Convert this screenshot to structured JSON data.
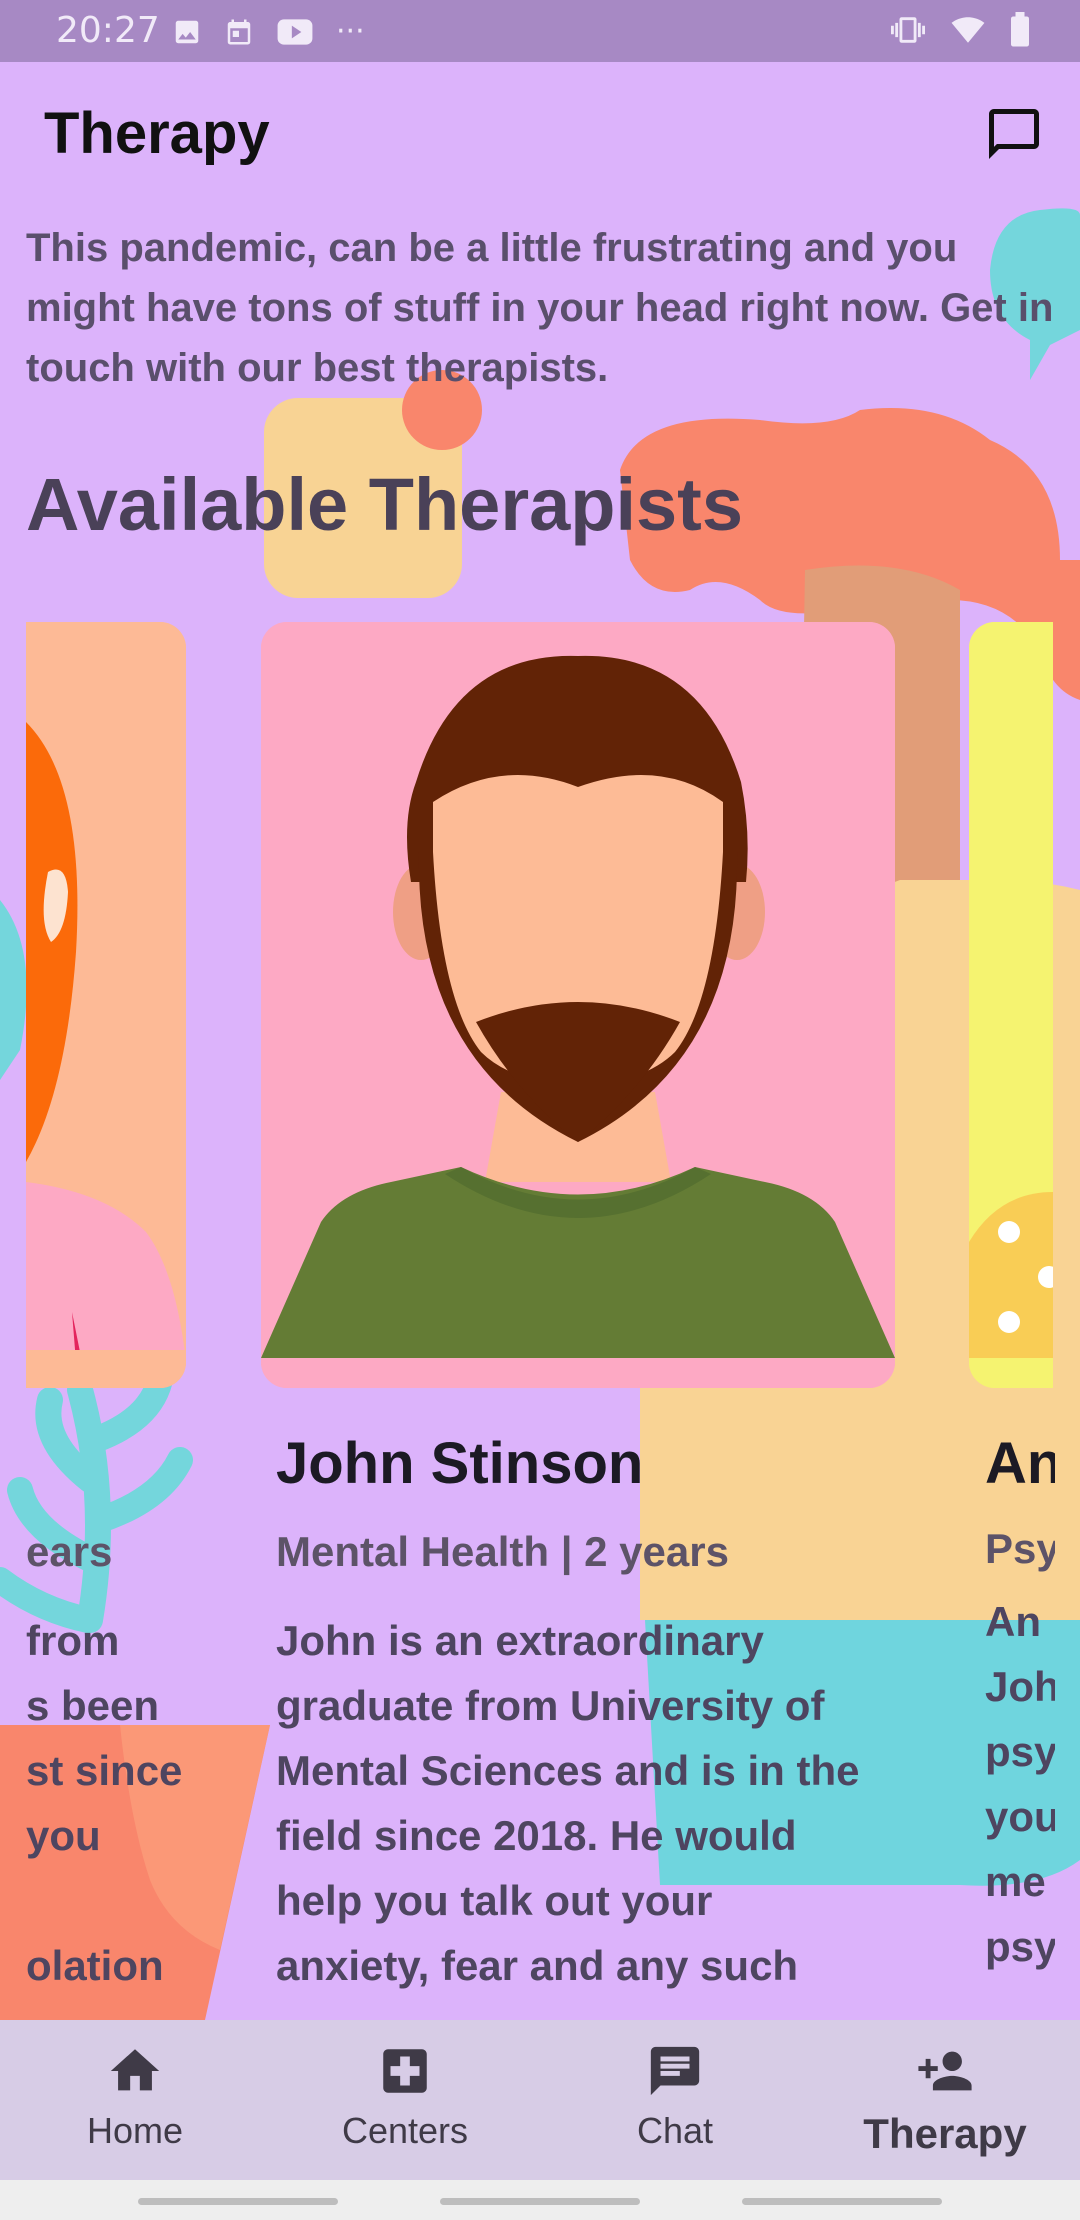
{
  "status_bar": {
    "time": "20:27",
    "overflow": "···"
  },
  "app_bar": {
    "title": "Therapy",
    "chat_icon": "chat-bubble-outline-icon"
  },
  "intro_text": "This pandemic, can be a little frustrating and you might have tons of stuff in your head right now. Get in touch with our best therapists.",
  "section_title": "Available Therapists",
  "therapists": [
    {
      "name": "",
      "specialty": "ears",
      "description_lines": [
        "from",
        "s been",
        "st since",
        "you",
        "",
        "olation"
      ]
    },
    {
      "name": "John Stinson",
      "specialty": "Mental Health | 2 years",
      "description_lines": [
        "John is an extraordinary",
        "graduate from University of",
        "Mental Sciences and is in the",
        "field since 2018. He would",
        "help you talk out your",
        "anxiety, fear and any such"
      ]
    },
    {
      "name": "An",
      "specialty": "Psy",
      "description_lines": [
        "An",
        "Joh",
        "psy",
        "you",
        "me",
        "psy"
      ]
    }
  ],
  "nav": {
    "items": [
      {
        "label": "Home",
        "icon": "home-icon"
      },
      {
        "label": "Centers",
        "icon": "medical-plus-icon"
      },
      {
        "label": "Chat",
        "icon": "chat-icon"
      },
      {
        "label": "Therapy",
        "icon": "person-add-icon"
      }
    ],
    "active": "Therapy"
  },
  "colors": {
    "background": "#dcb3fb",
    "status_bar": "#a789c4",
    "nav_bar": "#d7cce6",
    "card_main": "#fda9c4",
    "card_prev": "#fdba96",
    "card_next": "#f5f370",
    "shirt": "#647c35",
    "hair": "#622306"
  }
}
